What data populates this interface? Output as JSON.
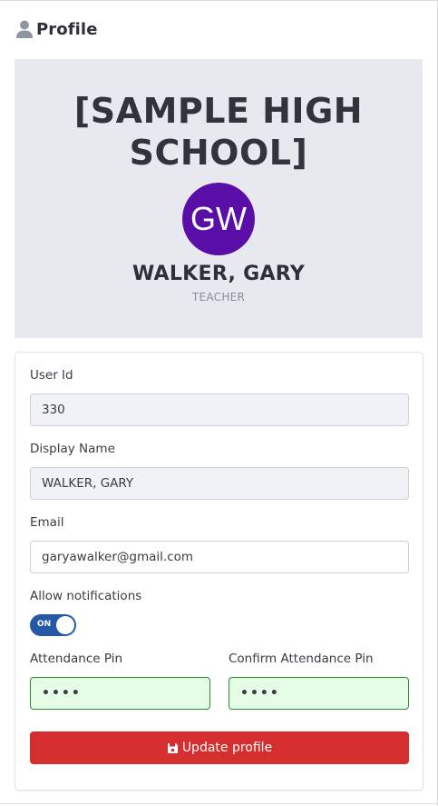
{
  "header": {
    "title": "Profile",
    "icon": "user-icon"
  },
  "banner": {
    "school_name": "[SAMPLE HIGH SCHOOL]",
    "avatar_initials": "GW",
    "avatar_color": "#5a0ea8",
    "user_name": "WALKER, GARY",
    "role": "TEACHER"
  },
  "form": {
    "user_id_label": "User Id",
    "user_id_value": "330",
    "display_name_label": "Display Name",
    "display_name_value": "WALKER, GARY",
    "email_label": "Email",
    "email_value": "garyawalker@gmail.com",
    "notifications_label": "Allow notifications",
    "notifications_toggle_label": "ON",
    "notifications_on": true,
    "attendance_pin_label": "Attendance Pin",
    "attendance_pin_value": "••••",
    "confirm_pin_label": "Confirm Attendance Pin",
    "confirm_pin_value": "••••",
    "update_button_label": "Update profile",
    "update_button_icon": "floppy-disk-icon",
    "update_button_color": "#d42e2e",
    "toggle_color": "#2659a3"
  }
}
